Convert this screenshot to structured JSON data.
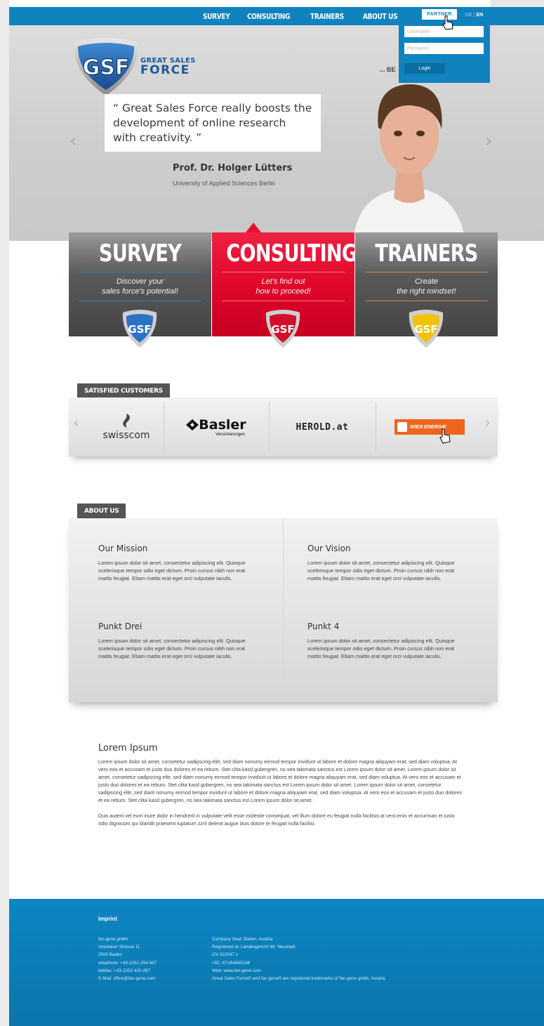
{
  "nav": {
    "items": [
      "SURVEY",
      "CONSULTING",
      "TRAINERS",
      "ABOUT US"
    ],
    "lang_de": "DE",
    "lang_sep": "|",
    "lang_en": "EN"
  },
  "login": {
    "partner_label": "PARTNER",
    "username_placeholder": "Username",
    "password_placeholder": "Password",
    "button_label": "Login"
  },
  "brand": {
    "logo_text": "GSF",
    "name_line1": "GREAT SALES",
    "name_line2": "FORCE",
    "tagline": "... BE"
  },
  "hero": {
    "quote": "“ Great Sales Force really boosts the development of online research with creativity. ”",
    "author": "Prof. Dr. Holger Lütters",
    "institution": "University of Applied Sciences Berlin"
  },
  "features": [
    {
      "title": "SURVEY",
      "subtitle_line1": "Discover your",
      "subtitle_line2": "sales force's potential!"
    },
    {
      "title": "CONSULTING",
      "subtitle_line1": "Let's find out",
      "subtitle_line2": "how to proceed!"
    },
    {
      "title": "TRAINERS",
      "subtitle_line1": "Create",
      "subtitle_line2": "the right mindset!"
    }
  ],
  "customers": {
    "label": "SATISFIED CUSTOMERS",
    "logos": [
      "swisscom",
      "Basler",
      "Versicherungen",
      "HEROLD.at",
      "WIEN ENERGIE"
    ]
  },
  "about": {
    "label": "ABOUT US",
    "items": [
      {
        "title": "Our Mission",
        "text": "Lorem ipsum dolor sit amet, consectetur adipiscing elit. Quisque scelerisque tempor odio eget dictum. Proin cursus nibh non erat mattis feugiat. Etiam mattis erat eget orci vulputate iaculis."
      },
      {
        "title": "Our Vision",
        "text": "Lorem ipsum dolor sit amet, consectetur adipiscing elit. Quisque scelerisque tempor odio eget dictum. Proin cursus nibh non erat mattis feugiat. Etiam mattis erat eget orci vulputate iaculis."
      },
      {
        "title": "Punkt Drei",
        "text": "Lorem ipsum dolor sit amet, consectetur adipiscing elit. Quisque scelerisque tempor odio eget dictum. Proin cursus nibh non erat mattis feugiat. Etiam mattis erat eget orci vulputate iaculis."
      },
      {
        "title": "Punkt 4",
        "text": "Lorem ipsum dolor sit amet, consectetur adipiscing elit. Quisque scelerisque tempor odio eget dictum. Proin cursus nibh non erat mattis feugiat. Etiam mattis erat eget orci vulputate iaculis."
      }
    ]
  },
  "lorem": {
    "title": "Lorem Ipsum",
    "p1": "Lorem ipsum dolor sit amet, consetetur sadipscing elitr, sed diam nonumy eirmod tempor invidunt ut labore et dolore magna aliquyam erat, sed diam voluptua. At vero eos et accusam et justo duo dolores et ea rebum. Stet clita kasd gubergren, no sea takimata sanctus est Lorem ipsum dolor sit amet. Lorem ipsum dolor sit amet, consetetur sadipscing elitr, sed diam nonumy eirmod tempor invidunt ut labore et dolore magna aliquyam erat, sed diam voluptua. At vero eos et accusam et justo duo dolores et ea rebum. Stet clita kasd gubergren, no sea takimata sanctus est Lorem ipsum dolor sit amet. Lorem ipsum dolor sit amet, consetetur sadipscing elitr, sed diam nonumy eirmod tempor invidunt ut labore et dolore magna aliquyam erat, sed diam voluptua. At vero eos et accusam et justo duo dolores et ea rebum. Stet clita kasd gubergren, no sea takimata sanctus est Lorem ipsum dolor sit amet.",
    "p2": "Duis autem vel eum iriure dolor in hendrerit in vulputate velit esse molestie consequat, vel illum dolore eu feugiat nulla facilisis at vero eros et accumsan et iusto odio dignissim qui blandit praesent luptatum zzril delenit augue duis dolore te feugait nulla facilisi."
  },
  "footer": {
    "title": "Imprint",
    "col1": [
      "fan gene gmbh",
      "Voeslauer Strasse 11",
      "2500 Baden",
      "telephone: +43-2252-254-587",
      "telefax: +43-2252-420-267",
      "E-Mail: office@fan-gene.com"
    ],
    "col2": [
      "Company Seat: Baden, Austria",
      "Registered at: Landesgericht Wr. Neustadt",
      "CN 322047 z",
      "UID: ATU64665188",
      "Web: www.fan-gene.com",
      "Great Sales Force® and fan gene® are registered trademarks of fan gene gmbh, Austria."
    ]
  },
  "colors": {
    "brand_blue": "#1083bf",
    "consulting_red": "#e0082a",
    "box_gray": "#4f4f4f",
    "trainers_gold": "#f2c200",
    "energie_orange": "#f0641e"
  },
  "icons": [
    "gsf-shield-logo",
    "prev-arrow",
    "next-arrow",
    "hand-cursor-icon",
    "swisscom-logo",
    "basler-logo",
    "herold-logo",
    "wien-energie-logo"
  ]
}
